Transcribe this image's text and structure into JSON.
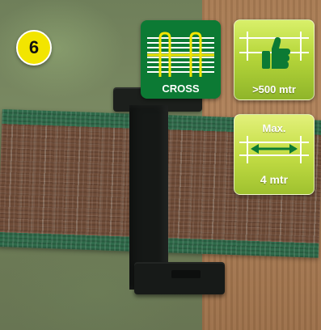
{
  "step": {
    "number": "6"
  },
  "badges": {
    "cross": {
      "label": "CROSS",
      "icon": "tape-cross-icon",
      "color": "#0c7a34"
    },
    "distance": {
      "label": ">500 mtr",
      "icon": "thumbs-up-icon",
      "color": "#b6d63a"
    },
    "max_span": {
      "top_label": "Max.",
      "bottom_label": "4 mtr",
      "icon": "span-arrow-icon",
      "color": "#c4de45"
    }
  }
}
